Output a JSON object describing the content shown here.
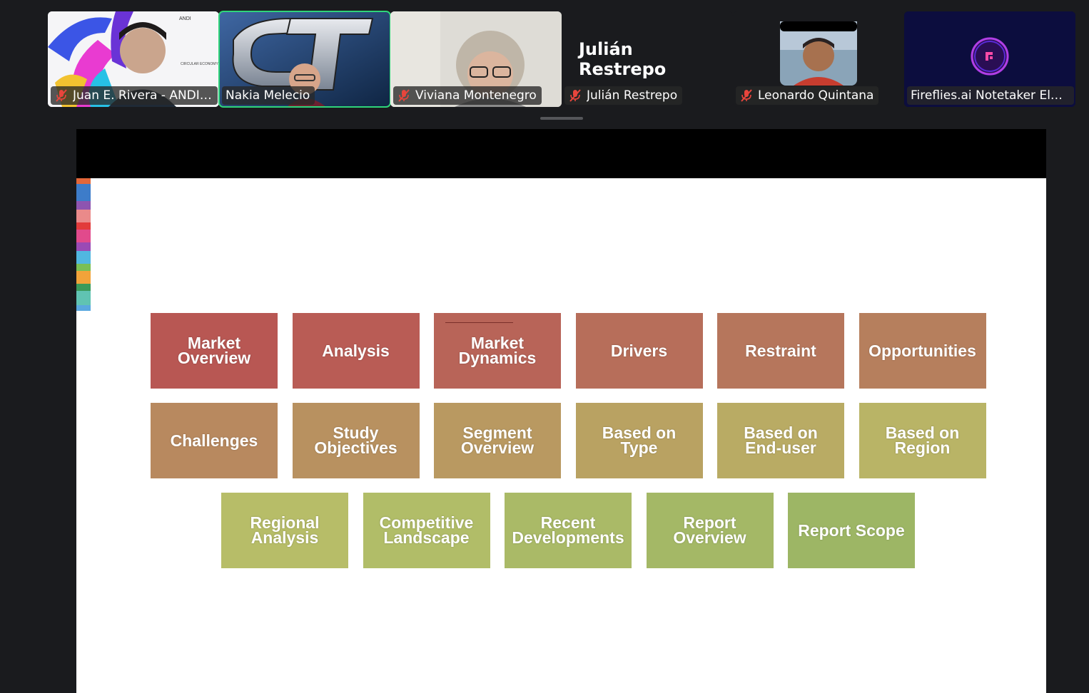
{
  "meeting": {
    "participants": [
      {
        "name": "Juan E. Rivera - ANDI ...",
        "muted": true,
        "video": true
      },
      {
        "name": "Nakia Melecio",
        "muted": false,
        "video": true,
        "active_speaker": true
      },
      {
        "name": "Viviana Montenegro",
        "muted": true,
        "video": true
      },
      {
        "name": "Julián Restrepo",
        "muted": true,
        "video": false,
        "display_name": "Julián Restrepo"
      },
      {
        "name": "Leonardo Quintana",
        "muted": true,
        "video": true
      },
      {
        "name": "Fireflies.ai Notetaker Elys ...",
        "muted": false,
        "video": true
      }
    ],
    "colors": {
      "active_border": "#2fd57a",
      "muted_icon": "#e8453c"
    }
  },
  "slide": {
    "topics_row1": [
      {
        "label": "Market Overview",
        "color": "#b85753"
      },
      {
        "label": "Analysis",
        "color": "#b95c55"
      },
      {
        "label": "Market Dynamics",
        "color": "#b86458"
      },
      {
        "label": "Drivers",
        "color": "#b76e5a"
      },
      {
        "label": "Restraint",
        "color": "#b6765c"
      },
      {
        "label": "Opportunities",
        "color": "#b67f5d"
      }
    ],
    "topics_row2": [
      {
        "label": "Challenges",
        "color": "#b8895f"
      },
      {
        "label": "Study Objectives",
        "color": "#b89160"
      },
      {
        "label": "Segment Overview",
        "color": "#b99961"
      },
      {
        "label": "Based on Type",
        "color": "#b9a262"
      },
      {
        "label": "Based on End-user",
        "color": "#b9ab64"
      },
      {
        "label": "Based on Region",
        "color": "#b9b466"
      }
    ],
    "topics_row3": [
      {
        "label": "Regional Analysis",
        "color": "#b7bd68"
      },
      {
        "label": "Competitive Landscape",
        "color": "#b1bd68"
      },
      {
        "label": "Recent Developments",
        "color": "#aaba67"
      },
      {
        "label": "Report Overview",
        "color": "#a4b866"
      },
      {
        "label": "Report Scope",
        "color": "#9db665"
      }
    ]
  }
}
